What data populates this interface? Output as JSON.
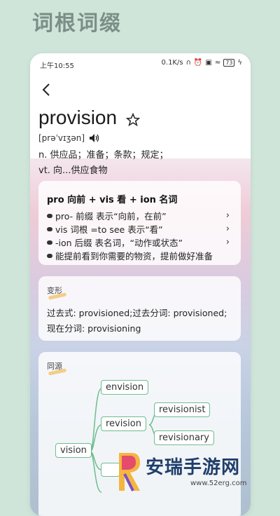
{
  "banner": "词根词缀",
  "status": {
    "time": "上午10:55",
    "net": "0.1K/s",
    "battery": "73"
  },
  "word": "provision",
  "phonetic": "[prəˈvɪʒən]",
  "definitions": [
    "n. 供应品；准备；条款；规定；",
    "vt. 向...供应食物"
  ],
  "root_card": {
    "head": "pro 向前 + vis 看 + ion 名词",
    "items": [
      {
        "text": "pro- 前缀 表示“向前，在前”",
        "arrow": true
      },
      {
        "text": "vis 词根 =to see 表示“看”",
        "arrow": true
      },
      {
        "text": "-ion 后缀 表名词，“动作或状态”",
        "arrow": true
      },
      {
        "text": "能提前看到你需要的物资，提前做好准备",
        "arrow": false
      }
    ]
  },
  "inflection_card": {
    "title": "变形",
    "line1": "过去式: provisioned;过去分词: provisioned;",
    "line2": "现在分词: provisioning"
  },
  "cognate_card": {
    "title": "同源",
    "nodes": [
      "vision",
      "envision",
      "revision",
      "revisionist",
      "revisionary"
    ]
  },
  "watermark": {
    "text": "安瑞手游网",
    "url": "www.52erg.com"
  }
}
